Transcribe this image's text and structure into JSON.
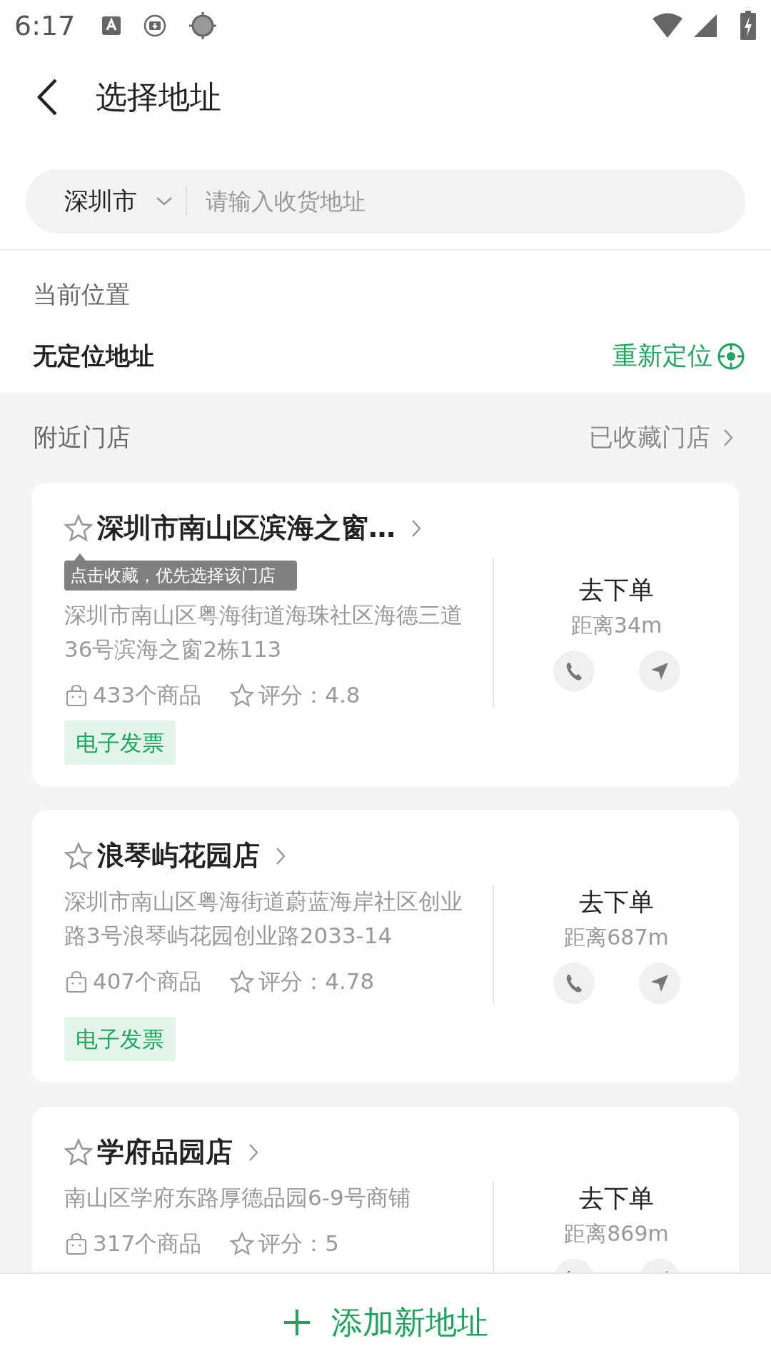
{
  "status_bar": {
    "time": "6:17"
  },
  "header": {
    "title": "选择地址"
  },
  "search": {
    "city": "深圳市",
    "placeholder": "请输入收货地址"
  },
  "current_location": {
    "label": "当前位置",
    "address": "无定位地址",
    "relocate": "重新定位"
  },
  "nearby": {
    "title": "附近门店",
    "favorites_link": "已收藏门店"
  },
  "stores": [
    {
      "name": "深圳市南山区滨海之窗…",
      "favorite": false,
      "tooltip": "点击收藏，优先选择该门店",
      "address": "深圳市南山区粤海街道海珠社区海德三道36号滨海之窗2栋113",
      "products": "433个商品",
      "rating": "评分：4.8",
      "tag": "电子发票",
      "order": "去下单",
      "distance": "距离34m"
    },
    {
      "name": "浪琴屿花园店",
      "favorite": false,
      "address": "深圳市南山区粤海街道蔚蓝海岸社区创业路3号浪琴屿花园创业路2033-14",
      "products": "407个商品",
      "rating": "评分：4.78",
      "tag": "电子发票",
      "order": "去下单",
      "distance": "距离687m"
    },
    {
      "name": "学府品园店",
      "favorite": false,
      "address": "南山区学府东路厚德品园6-9号商铺",
      "products": "317个商品",
      "rating": "评分：5",
      "order": "去下单",
      "distance": "距离869m"
    }
  ],
  "bottom_button": {
    "label": "添加新地址"
  }
}
